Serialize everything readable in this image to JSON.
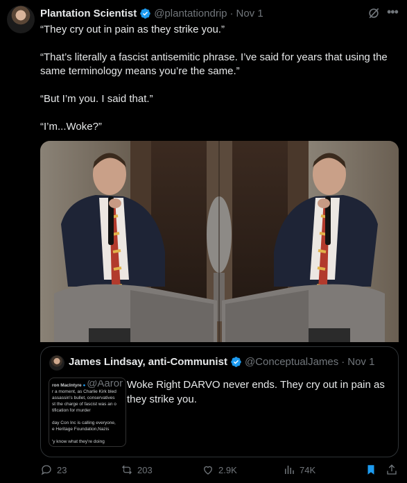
{
  "post": {
    "author_name": "Plantation Scientist",
    "handle": "@plantationdrip",
    "separator": "·",
    "date": "Nov 1",
    "paragraphs": [
      "“They cry out in pain as they strike you.”",
      "“That’s literally a fascist antisemitic phrase. I’ve said for years that using the same terminology means you’re the same.”",
      "“But I’m you. I said that.”",
      "“I’m...Woke?”"
    ]
  },
  "quote": {
    "author_name": "James Lindsay, anti-Communist",
    "handle": "@ConceptualJames",
    "separator": "·",
    "date": "Nov 1",
    "text": "Woke Right DARVO never ends. They cry out in pain as they strike you.",
    "thumbnail_lines": [
      "ron MacIntyre",
      "@AaronMacl",
      "r a moment, as Charlie Kirk bled",
      "assassin's bullet, conservatives",
      "st the charge of fascist was an o",
      "tification for murder",
      "day Con Inc is calling everyone,",
      "e Heritage Foundation,Nazis",
      "'y know what they're doing"
    ]
  },
  "actions": {
    "replies": "23",
    "reposts": "203",
    "likes": "2.9K",
    "views": "74K"
  },
  "icons": {
    "verified": "verified-badge-icon",
    "grok": "grok-icon",
    "more": "more-icon",
    "reply": "reply-icon",
    "repost": "repost-icon",
    "like": "like-icon",
    "views": "views-icon",
    "bookmark": "bookmark-icon",
    "share": "share-icon"
  },
  "colors": {
    "background": "#000000",
    "text": "#e7e9ea",
    "muted": "#71767b",
    "verified": "#1d9bf0",
    "bookmark_active": "#1d9bf0",
    "border": "#2f3336"
  }
}
